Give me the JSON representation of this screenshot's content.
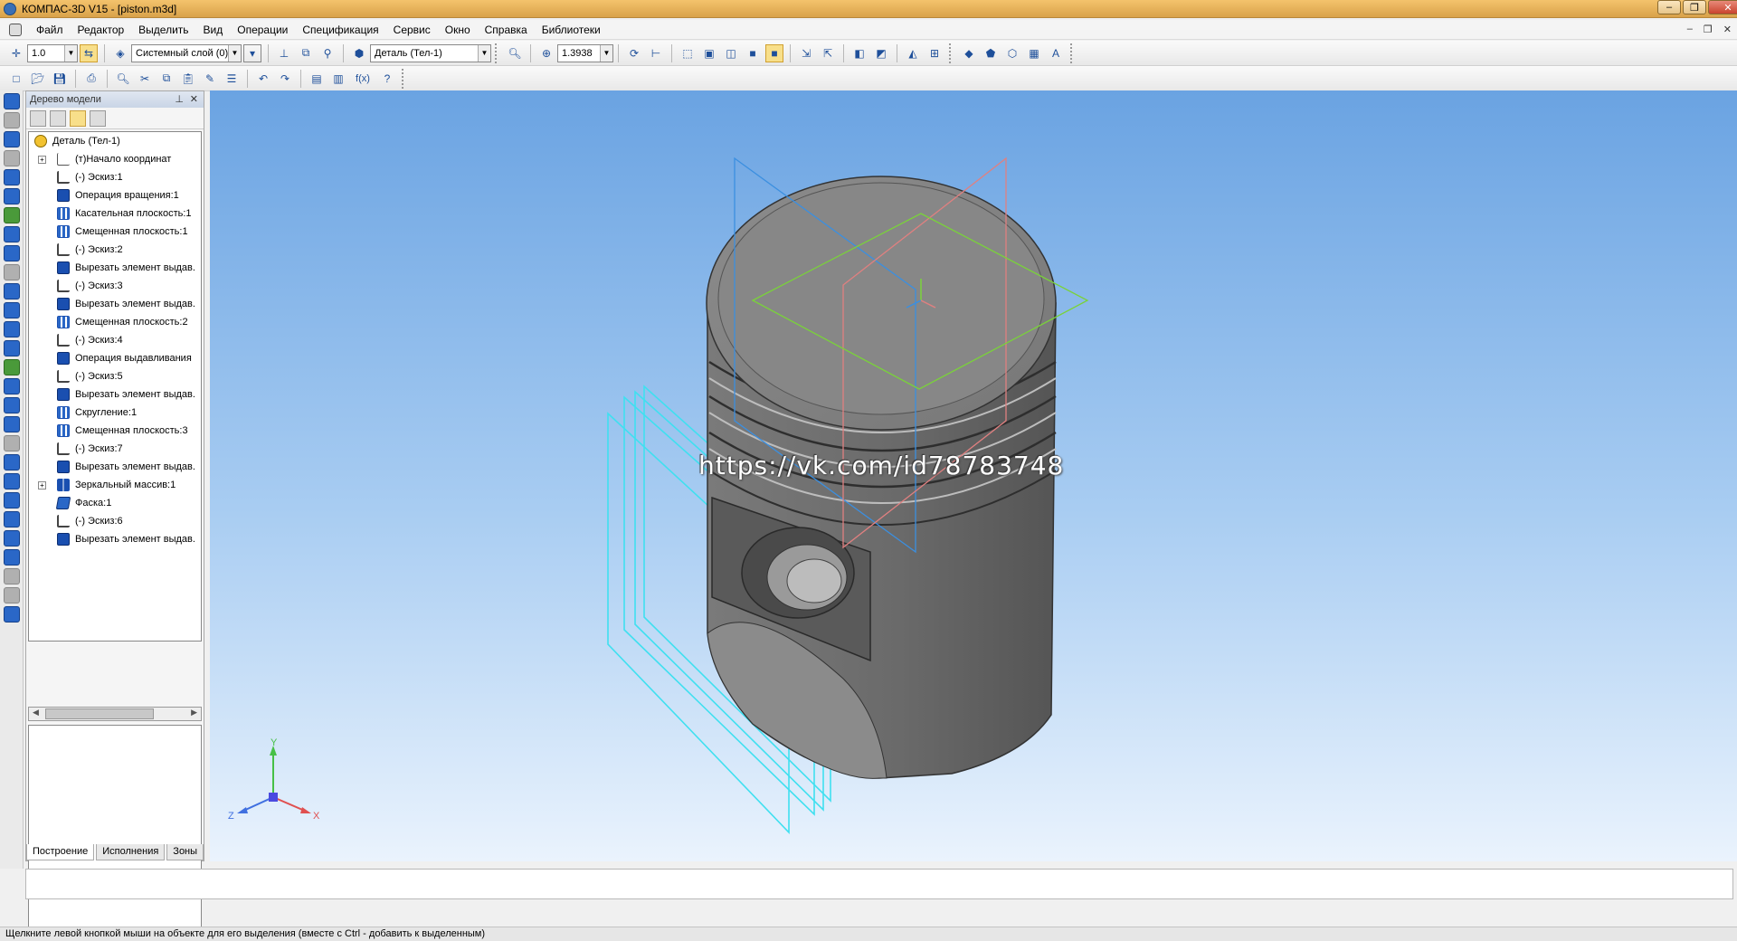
{
  "window": {
    "title": "КОМПАС-3D V15 - [piston.m3d]"
  },
  "menu": {
    "items": [
      "Файл",
      "Редактор",
      "Выделить",
      "Вид",
      "Операции",
      "Спецификация",
      "Сервис",
      "Окно",
      "Справка",
      "Библиотеки"
    ]
  },
  "toolbar_main": {
    "step_value": "1.0",
    "layer_value": "Системный слой (0)",
    "body_value": "Деталь (Тел-1)",
    "zoom_value": "1.3938"
  },
  "toolbar_standard": {
    "fx_label": "f(x)"
  },
  "tree": {
    "header": "Дерево модели",
    "root": "Деталь (Тел-1)",
    "items": [
      {
        "label": "(т)Начало координат",
        "icon": "origin-icon"
      },
      {
        "label": "(-) Эскиз:1",
        "icon": "sketch-icon"
      },
      {
        "label": "Операция вращения:1",
        "icon": "revolve-icon"
      },
      {
        "label": "Касательная плоскость:1",
        "icon": "plane-icon"
      },
      {
        "label": "Смещенная плоскость:1",
        "icon": "plane-icon"
      },
      {
        "label": "(-) Эскиз:2",
        "icon": "sketch-icon"
      },
      {
        "label": "Вырезать элемент выдав.",
        "icon": "cut-extrude-icon"
      },
      {
        "label": "(-) Эскиз:3",
        "icon": "sketch-icon"
      },
      {
        "label": "Вырезать элемент выдав.",
        "icon": "cut-extrude-icon"
      },
      {
        "label": "Смещенная плоскость:2",
        "icon": "plane-icon"
      },
      {
        "label": "(-) Эскиз:4",
        "icon": "sketch-icon"
      },
      {
        "label": "Операция выдавливания",
        "icon": "extrude-icon"
      },
      {
        "label": "(-) Эскиз:5",
        "icon": "sketch-icon"
      },
      {
        "label": "Вырезать элемент выдав.",
        "icon": "cut-extrude-icon"
      },
      {
        "label": "Скругление:1",
        "icon": "fillet-icon"
      },
      {
        "label": "Смещенная плоскость:3",
        "icon": "plane-icon"
      },
      {
        "label": "(-) Эскиз:7",
        "icon": "sketch-icon"
      },
      {
        "label": "Вырезать элемент выдав.",
        "icon": "cut-extrude-icon"
      },
      {
        "label": "Зеркальный массив:1",
        "icon": "mirror-icon"
      },
      {
        "label": "Фаска:1",
        "icon": "chamfer-icon"
      },
      {
        "label": "(-) Эскиз:6",
        "icon": "sketch-icon"
      },
      {
        "label": "Вырезать элемент выдав.",
        "icon": "cut-extrude-icon"
      }
    ],
    "tabs": [
      "Построение",
      "Исполнения",
      "Зоны"
    ]
  },
  "viewport": {
    "watermark": "https://vk.com/id78783748",
    "axis_labels": {
      "x": "X",
      "y": "Y",
      "z": "Z"
    }
  },
  "status": {
    "hint": "Щелкните левой кнопкой мыши на объекте для его выделения (вместе с Ctrl - добавить к выделенным)"
  },
  "colors": {
    "title_bar": "#e8b25a",
    "viewport_top": "#6aa3e2",
    "viewport_bottom": "#eaf3fd",
    "piston_body": "#6b6b6b",
    "plane_cyan": "#3fe0f0"
  }
}
